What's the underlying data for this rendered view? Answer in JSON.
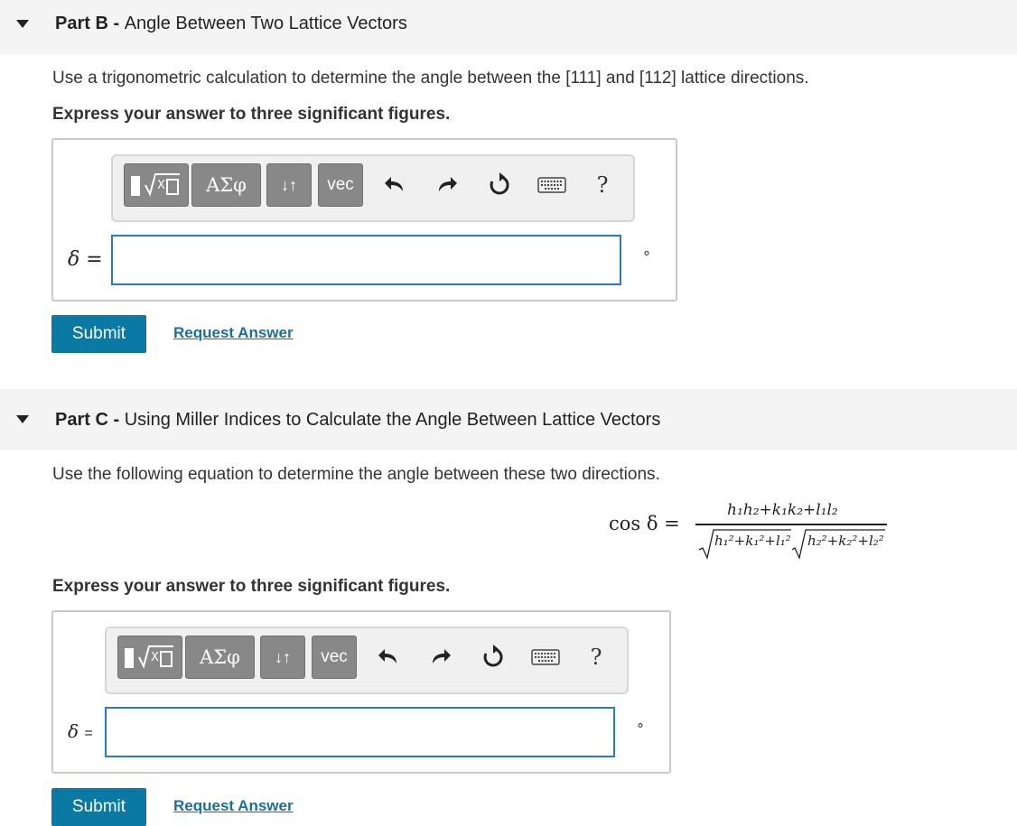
{
  "part_b": {
    "label": "Part B",
    "separator": " - ",
    "title": "Angle Between Two Lattice Vectors",
    "instruction": "Use a trigonometric calculation to determine the angle between the [111] and [112] lattice directions.",
    "precision_note": "Express your answer to three significant figures.",
    "answer_label": "δ",
    "equals": "=",
    "input_value": "",
    "unit": "∘",
    "submit_label": "Submit",
    "request_label": "Request Answer"
  },
  "part_c": {
    "label": "Part C",
    "separator": " - ",
    "title": "Using Miller Indices to Calculate the Angle Between Lattice Vectors",
    "instruction": "Use the following equation to determine the angle between these two directions.",
    "precision_note": "Express your answer to three significant figures.",
    "answer_label": "δ",
    "equals": "=",
    "input_value": "",
    "unit": "∘",
    "submit_label": "Submit",
    "request_label": "Request Answer"
  },
  "toolbar": {
    "greek_label": "ΑΣφ",
    "arrows_label": "↓↑",
    "vec_label": "vec",
    "help_label": "?",
    "icons": [
      "templates-icon",
      "greek-letters-icon",
      "arrows-icon",
      "vec-icon",
      "undo-icon",
      "redo-icon",
      "reset-icon",
      "keyboard-icon",
      "help-icon"
    ]
  },
  "equation": {
    "lhs": "cos δ =",
    "numerator": "h₁h₂+k₁k₂+l₁l₂",
    "denominator_left": "h₁²+k₁²+l₁²",
    "denominator_right": "h₂²+k₂²+l₂²"
  },
  "colors": {
    "header_bg": "#f4f4f4",
    "submit_bg": "#0a7aa4",
    "link": "#1a6fa1",
    "input_border": "#2a7abf",
    "toolbar_button": "#888888"
  }
}
